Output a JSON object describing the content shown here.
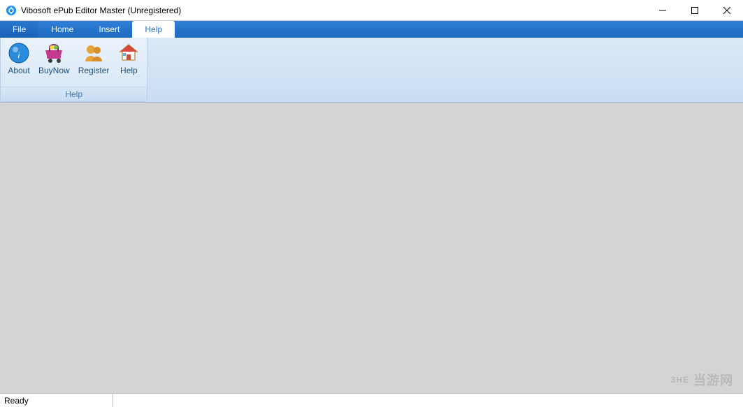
{
  "window": {
    "title": "Vibosoft ePub Editor Master (Unregistered)"
  },
  "tabs": {
    "file": "File",
    "home": "Home",
    "insert": "Insert",
    "help": "Help"
  },
  "ribbon": {
    "help_group": {
      "title": "Help",
      "about": "About",
      "buynow": "BuyNow",
      "register": "Register",
      "help": "Help"
    }
  },
  "status": {
    "ready": "Ready"
  },
  "watermark": {
    "brand": "3HE",
    "text": "当游网"
  }
}
